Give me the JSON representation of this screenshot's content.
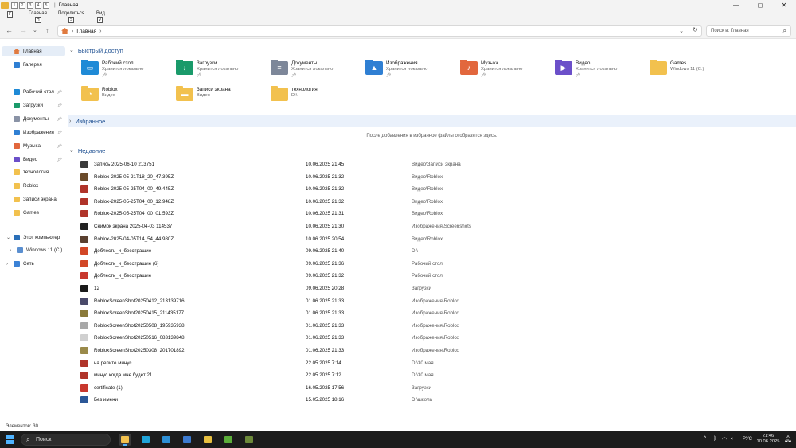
{
  "window": {
    "title": "Главная",
    "controls": {
      "minimize": "—",
      "maximize": "◻",
      "close": "✕"
    },
    "qat_keys": [
      "1",
      "2",
      "3",
      "4",
      "5"
    ]
  },
  "ribbon": {
    "tabs": [
      {
        "label": "Файл",
        "key": "F"
      },
      {
        "label": "Главная",
        "key": "H"
      },
      {
        "label": "Поделиться",
        "key": "S"
      },
      {
        "label": "Вид",
        "key": "V"
      }
    ]
  },
  "address": {
    "crumb": "Главная",
    "search_placeholder": "Поиск в: Главная"
  },
  "sidebar": {
    "home": "Главная",
    "gallery": "Галерея",
    "pinned": [
      {
        "label": "Рабочий стол",
        "color": "#1f8ad6",
        "pinned": true
      },
      {
        "label": "Загрузки",
        "color": "#1a9a6a",
        "pinned": true
      },
      {
        "label": "Документы",
        "color": "#8a93a6",
        "pinned": true
      },
      {
        "label": "Изображения",
        "color": "#2f7fd3",
        "pinned": true
      },
      {
        "label": "Музыка",
        "color": "#e2673d",
        "pinned": true
      },
      {
        "label": "Видео",
        "color": "#6b4fc9",
        "pinned": true
      },
      {
        "label": "технология",
        "color": "#f2c14e",
        "pinned": false
      },
      {
        "label": "Roblox",
        "color": "#f2c14e",
        "pinned": false
      },
      {
        "label": "Записи экрана",
        "color": "#f2c14e",
        "pinned": false
      },
      {
        "label": "Games",
        "color": "#f2c14e",
        "pinned": false
      }
    ],
    "computer": "Этот компьютер",
    "drive": "Windows 11 (C:)",
    "network": "Сеть"
  },
  "sections": {
    "quick_access": "Быстрый доступ",
    "favorites": "Избранное",
    "favorites_empty": "После добавления в избранное файлы отобразятся здесь.",
    "recent": "Недавние"
  },
  "quick_access": [
    {
      "name": "Рабочий стол",
      "sub": "Хранится локально",
      "pinned": true,
      "color": "#1f8ad6",
      "icon": "desktop-icon",
      "glyph": "▭"
    },
    {
      "name": "Загрузки",
      "sub": "Хранится локально",
      "pinned": true,
      "color": "#1a9a6a",
      "icon": "download-icon",
      "glyph": "↓"
    },
    {
      "name": "Документы",
      "sub": "Хранится локально",
      "pinned": true,
      "color": "#7d8799",
      "icon": "document-icon",
      "glyph": "≡"
    },
    {
      "name": "Изображения",
      "sub": "Хранится локально",
      "pinned": true,
      "color": "#2f7fd3",
      "icon": "image-icon",
      "glyph": "▲"
    },
    {
      "name": "Музыка",
      "sub": "Хранится локально",
      "pinned": true,
      "color": "#e2673d",
      "icon": "music-icon",
      "glyph": "♪"
    },
    {
      "name": "Видео",
      "sub": "Хранится локально",
      "pinned": true,
      "color": "#6b4fc9",
      "icon": "video-icon",
      "glyph": "▶"
    },
    {
      "name": "Games",
      "sub": "Windows 11 (C:)",
      "pinned": false,
      "color": "#f2c14e",
      "icon": "folder-icon",
      "glyph": ""
    },
    {
      "name": "Roblox",
      "sub": "Видео",
      "pinned": false,
      "color": "#f2c14e",
      "icon": "folder-icon",
      "glyph": "◔"
    },
    {
      "name": "Записи экрана",
      "sub": "Видео",
      "pinned": false,
      "color": "#f2c14e",
      "icon": "folder-icon",
      "glyph": "▬"
    },
    {
      "name": "технология",
      "sub": "D:\\",
      "pinned": false,
      "color": "#f2c14e",
      "icon": "folder-icon",
      "glyph": ""
    }
  ],
  "recent": [
    {
      "name": "Запись 2025-06-10 213751",
      "date": "10.06.2025 21:45",
      "location": "Видео\\Записи экрана",
      "color": "#3a3a3a",
      "icon": "video-file-icon"
    },
    {
      "name": "Roblox-2025-05-21T18_20_47.395Z",
      "date": "10.06.2025 21:32",
      "location": "Видео\\Roblox",
      "color": "#6a4a2a",
      "icon": "video-file-icon"
    },
    {
      "name": "Roblox-2025-05-25T04_00_49.445Z",
      "date": "10.06.2025 21:32",
      "location": "Видео\\Roblox",
      "color": "#b0342a",
      "icon": "media-player-icon"
    },
    {
      "name": "Roblox-2025-05-25T04_00_12.948Z",
      "date": "10.06.2025 21:32",
      "location": "Видео\\Roblox",
      "color": "#b0342a",
      "icon": "media-player-icon"
    },
    {
      "name": "Roblox-2025-05-25T04_00_01.593Z",
      "date": "10.06.2025 21:31",
      "location": "Видео\\Roblox",
      "color": "#b0342a",
      "icon": "media-player-icon"
    },
    {
      "name": "Снимок экрана 2025-04-03 114537",
      "date": "10.06.2025 21:30",
      "location": "Изображения\\Screenshots",
      "color": "#222222",
      "icon": "image-file-icon"
    },
    {
      "name": "Roblox-2025-04-05T14_54_44.980Z",
      "date": "10.06.2025 20:54",
      "location": "Видео\\Roblox",
      "color": "#5a4030",
      "icon": "video-file-icon"
    },
    {
      "name": "Доблесть_и_бесстрашие",
      "date": "09.06.2025 21:40",
      "location": "D:\\",
      "color": "#d24726",
      "icon": "powerpoint-icon"
    },
    {
      "name": "Доблесть_и_бесстрашие (6)",
      "date": "09.06.2025 21:36",
      "location": "Рабочий стол",
      "color": "#d24726",
      "icon": "powerpoint-icon"
    },
    {
      "name": "Доблесть_и_бесстрашие",
      "date": "09.06.2025 21:32",
      "location": "Рабочий стол",
      "color": "#c8372d",
      "icon": "pdf-icon"
    },
    {
      "name": "12",
      "date": "09.06.2025 20:28",
      "location": "Загрузки",
      "color": "#1a1a1a",
      "icon": "image-file-icon"
    },
    {
      "name": "RobloxScreenShot20250412_213139716",
      "date": "01.06.2025 21:33",
      "location": "Изображения\\Roblox",
      "color": "#4a4a6a",
      "icon": "image-file-icon"
    },
    {
      "name": "RobloxScreenShot20250415_211435177",
      "date": "01.06.2025 21:33",
      "location": "Изображения\\Roblox",
      "color": "#8a7a3a",
      "icon": "image-file-icon"
    },
    {
      "name": "RobloxScreenShot20250508_195935938",
      "date": "01.06.2025 21:33",
      "location": "Изображения\\Roblox",
      "color": "#a8a8a8",
      "icon": "image-file-icon"
    },
    {
      "name": "RobloxScreenShot20250516_083139848",
      "date": "01.06.2025 21:33",
      "location": "Изображения\\Roblox",
      "color": "#d0d0d0",
      "icon": "image-file-icon"
    },
    {
      "name": "RobloxScreenShot20250308_201701892",
      "date": "01.06.2025 21:33",
      "location": "Изображения\\Roblox",
      "color": "#9a8a4a",
      "icon": "image-file-icon"
    },
    {
      "name": "на репите минус",
      "date": "22.05.2025 7:14",
      "location": "D:\\30 мая",
      "color": "#b0342a",
      "icon": "media-player-icon"
    },
    {
      "name": "минус когда мне будет 21",
      "date": "22.05.2025 7:12",
      "location": "D:\\30 мая",
      "color": "#b0342a",
      "icon": "media-player-icon"
    },
    {
      "name": "certificate (1)",
      "date": "16.05.2025 17:56",
      "location": "Загрузки",
      "color": "#c8372d",
      "icon": "pdf-icon"
    },
    {
      "name": "Без имени",
      "date": "15.05.2025 18:16",
      "location": "D:\\школа",
      "color": "#2b5797",
      "icon": "word-icon"
    }
  ],
  "status": {
    "items_count": "Элементов: 30"
  },
  "taskbar": {
    "search_label": "Поиск",
    "apps": [
      {
        "name": "file-explorer",
        "color": "#f2c14e",
        "active": true
      },
      {
        "name": "edge",
        "color": "#1fa3d8",
        "active": false
      },
      {
        "name": "mail",
        "color": "#2d8fd5",
        "active": false
      },
      {
        "name": "save",
        "color": "#3d7bd0",
        "active": false
      },
      {
        "name": "store",
        "color": "#e8c040",
        "active": false
      },
      {
        "name": "minecraft",
        "color": "#5cae3a",
        "active": false
      },
      {
        "name": "minecraft-2",
        "color": "#6d8a3a",
        "active": false
      }
    ],
    "tray": {
      "chevron": "^",
      "lang": "РУС"
    },
    "time": "21:46",
    "date": "10.06.2025"
  }
}
